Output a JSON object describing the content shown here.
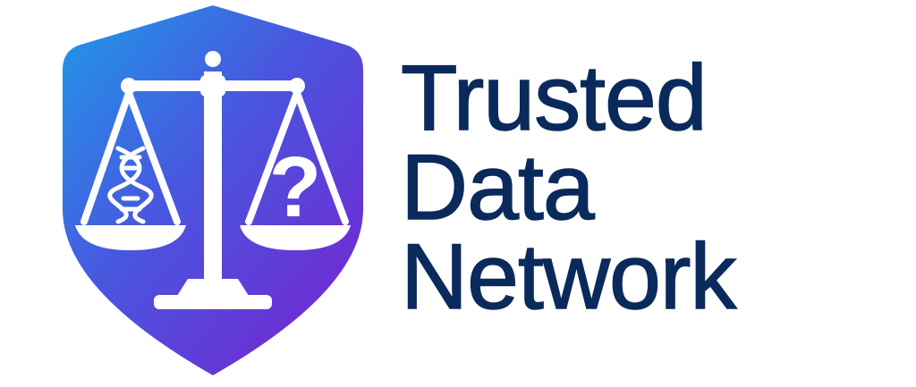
{
  "brand": {
    "name_lines": [
      "Trusted",
      "Data",
      "Network"
    ],
    "colors": {
      "wordmark": "#0b2a5c",
      "shield_gradient_start": "#1e9ae8",
      "shield_gradient_mid": "#4a55de",
      "shield_gradient_end": "#7a1fd0",
      "emblem": "#ffffff"
    }
  },
  "emblem": {
    "shield_icon": "shield-icon",
    "scale_icon": "balance-scale-icon",
    "left_pan_icon": "dna-icon",
    "right_pan_icon": "question-mark-icon",
    "right_pan_glyph": "?"
  }
}
